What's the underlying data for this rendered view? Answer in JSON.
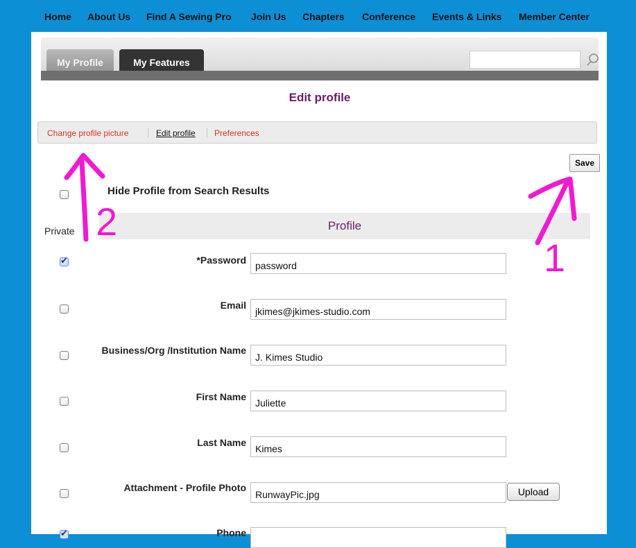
{
  "topnav": {
    "items": [
      "Home",
      "About Us",
      "Find A Sewing Pro",
      "Join Us",
      "Chapters",
      "Conference",
      "Events & Links",
      "Member Center"
    ]
  },
  "tabs": [
    {
      "label": "My Profile",
      "active": true
    },
    {
      "label": "My Features",
      "active": false
    }
  ],
  "search": {
    "placeholder": ""
  },
  "page_title": "Edit profile",
  "subnav": {
    "change_picture": "Change profile picture",
    "edit_profile": "Edit profile",
    "preferences": "Preferences"
  },
  "save_label": "Save",
  "hide_profile_label": "Hide Profile from Search Results",
  "private_label": "Private",
  "section_header": "Profile",
  "fields": [
    {
      "label": "*Password",
      "value": "password",
      "private": true
    },
    {
      "label": "Email",
      "value": "jkimes@jkimes-studio.com",
      "private": false
    },
    {
      "label": "Business/Org /Institution Name",
      "value": "J. Kimes Studio",
      "private": false
    },
    {
      "label": "First Name",
      "value": "Juliette",
      "private": false
    },
    {
      "label": "Last Name",
      "value": "Kimes",
      "private": false
    },
    {
      "label": "Attachment - Profile Photo",
      "value": "RunwayPic.jpg",
      "private": false
    },
    {
      "label": "Phone",
      "value": "",
      "private": true
    }
  ],
  "upload_label": "Upload",
  "annotations": {
    "one": "1",
    "two": "2"
  },
  "colors": {
    "background": "#0d8fd6",
    "accent": "#6a1d62",
    "link_red": "#d9351f",
    "annotation": "#f01ad0"
  }
}
